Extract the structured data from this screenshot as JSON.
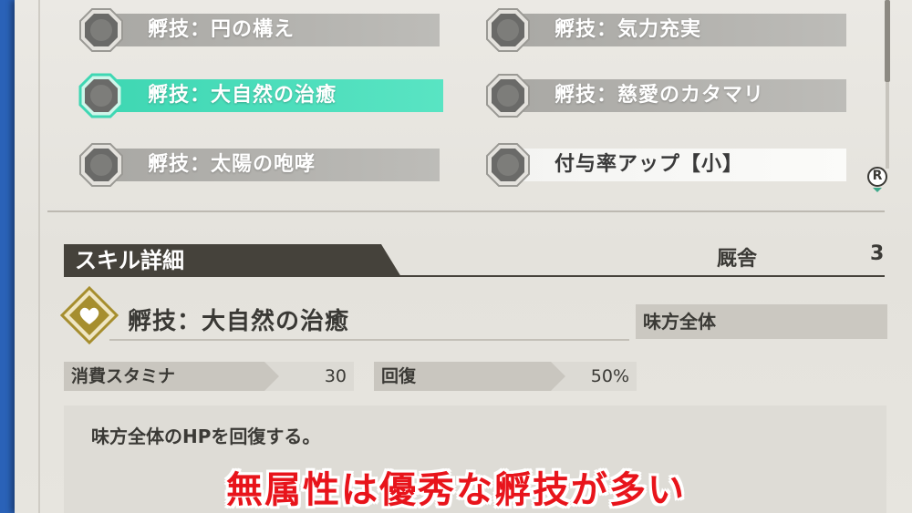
{
  "skills": [
    {
      "name": "孵技：円の構え",
      "state": "normal"
    },
    {
      "name": "孵技：気力充実",
      "state": "normal"
    },
    {
      "name": "孵技：大自然の治癒",
      "state": "selected"
    },
    {
      "name": "孵技：慈愛のカタマリ",
      "state": "normal"
    },
    {
      "name": "孵技：太陽の咆哮",
      "state": "normal"
    },
    {
      "name": "付与率アップ【小】",
      "state": "highlight"
    }
  ],
  "scroll_button": "R",
  "detail": {
    "header": "スキル詳細",
    "roost_label": "厩舎",
    "roost_value": "3",
    "skill_name": "孵技：大自然の治癒",
    "target": "味方全体",
    "stats": [
      {
        "label": "消費スタミナ",
        "value": "30"
      },
      {
        "label": "回復",
        "value": "50%"
      }
    ],
    "description": "味方全体のHPを回復する。"
  },
  "caption": "無属性は優秀な孵技が多い",
  "colors": {
    "selected": "#3fd7b3",
    "caption": "#e8141b",
    "header": "#45423b",
    "emblem": "#a68e2e"
  }
}
